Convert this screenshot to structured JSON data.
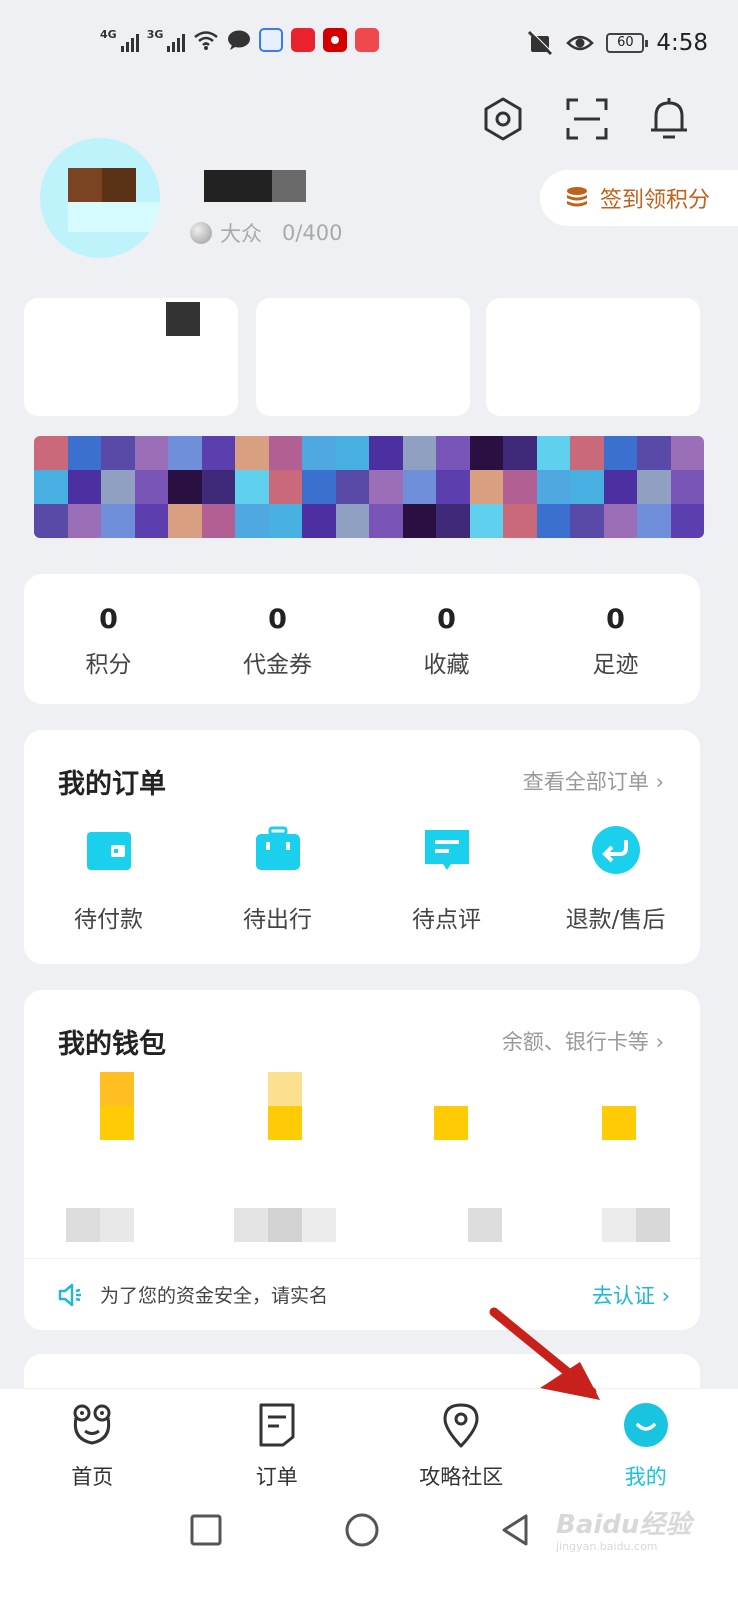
{
  "status_bar": {
    "signal1": "4G",
    "signal2": "3G",
    "battery": "60",
    "time": "4:58"
  },
  "header": {
    "icons": [
      "settings-icon",
      "scan-icon",
      "bell-icon"
    ]
  },
  "profile": {
    "level_name": "大众",
    "level_progress": "0/400",
    "signin_label": "签到领积分"
  },
  "stats": [
    {
      "value": "0",
      "label": "积分"
    },
    {
      "value": "0",
      "label": "代金券"
    },
    {
      "value": "0",
      "label": "收藏"
    },
    {
      "value": "0",
      "label": "足迹"
    }
  ],
  "orders": {
    "title": "我的订单",
    "link": "查看全部订单 ›",
    "items": [
      {
        "label": "待付款",
        "icon": "wallet-icon"
      },
      {
        "label": "待出行",
        "icon": "suitcase-icon"
      },
      {
        "label": "待点评",
        "icon": "review-icon"
      },
      {
        "label": "退款/售后",
        "icon": "refund-icon"
      }
    ]
  },
  "wallet": {
    "title": "我的钱包",
    "link": "余额、银行卡等 ›",
    "notice": "为了您的资金安全，请实名",
    "notice_link": "去认证 ›"
  },
  "bottom_nav": [
    {
      "label": "首页",
      "icon": "home-frog-icon"
    },
    {
      "label": "订单",
      "icon": "order-doc-icon"
    },
    {
      "label": "攻略社区",
      "icon": "location-pin-icon"
    },
    {
      "label": "我的",
      "icon": "smile-face-icon",
      "active": true
    }
  ],
  "watermark": {
    "text": "Baidu经验",
    "sub": "jingyan.baidu.com"
  },
  "colors": {
    "accent": "#18c4e0",
    "signin": "#c0601a",
    "background": "#eef0f3"
  }
}
